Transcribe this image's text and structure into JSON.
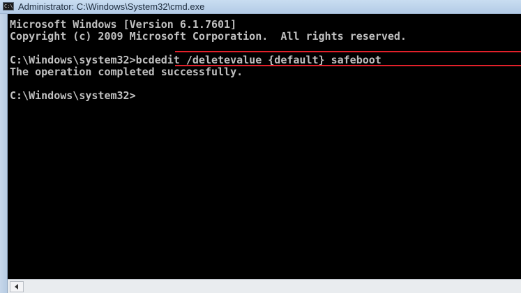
{
  "window": {
    "title": "Administrator: C:\\Windows\\System32\\cmd.exe",
    "icon": "cmd-icon",
    "icon_text": "C:\\"
  },
  "console": {
    "lines": [
      "Microsoft Windows [Version 6.1.7601]",
      "Copyright (c) 2009 Microsoft Corporation.  All rights reserved.",
      "C:\\Windows\\system32>bcdedit /deletevalue {default} safeboot",
      "The operation completed successfully.",
      "C:\\Windows\\system32>"
    ]
  },
  "annotation": {
    "color": "#e3202a"
  },
  "scrollbar": {
    "icon": "scroll-left-arrow-icon"
  },
  "colors": {
    "console_background": "#000000",
    "console_text": "#c0c0c0"
  }
}
